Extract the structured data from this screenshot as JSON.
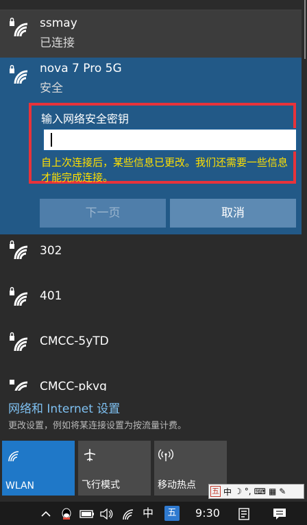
{
  "networks": {
    "connected": {
      "ssid": "ssmay",
      "status": "已连接"
    },
    "expanded": {
      "ssid": "nova 7 Pro 5G",
      "status": "安全",
      "key_label": "输入网络安全密钥",
      "key_value": "",
      "warning": "自上次连接后，某些信息已更改。我们还需要一些信息才能完成连接。",
      "next_label": "下一页",
      "cancel_label": "取消"
    },
    "others": [
      {
        "ssid": "302"
      },
      {
        "ssid": "401"
      },
      {
        "ssid": "CMCC-5yTD"
      },
      {
        "ssid": "CMCC-pkvg"
      }
    ]
  },
  "settings": {
    "link": "网络和 Internet 设置",
    "description": "更改设置，例如将某连接设置为按流量计费。"
  },
  "tiles": [
    {
      "label": "WLAN",
      "icon": "wifi-icon",
      "active": true
    },
    {
      "label": "飞行模式",
      "icon": "airplane-icon",
      "active": false
    },
    {
      "label": "移动热点",
      "icon": "hotspot-icon",
      "active": false
    }
  ],
  "ime_toolbar": {
    "logo": "五",
    "mode": "中"
  },
  "taskbar": {
    "lang": "中",
    "ime": "五",
    "time": "9:30"
  },
  "colors": {
    "accent": "#225987",
    "highlight_border": "#e8333a",
    "warning_text": "#ffe000",
    "link": "#7fc1f2",
    "wlan_tile": "#1f78c8"
  }
}
